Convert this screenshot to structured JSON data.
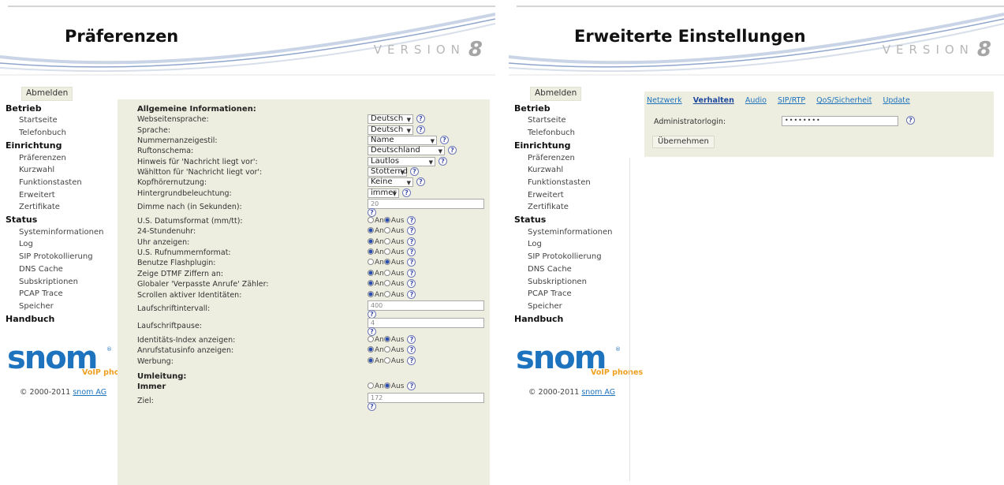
{
  "left": {
    "title": "Präferenzen",
    "version_text": "VERSION",
    "version_number": "8",
    "sidebar": {
      "logout": "Abmelden",
      "sections": [
        {
          "label": "Betrieb",
          "items": [
            "Startseite",
            "Telefonbuch"
          ]
        },
        {
          "label": "Einrichtung",
          "items": [
            "Präferenzen",
            "Kurzwahl",
            "Funktionstasten",
            "Erweitert",
            "Zertifikate"
          ]
        },
        {
          "label": "Status",
          "items": [
            "Systeminformationen",
            "Log",
            "SIP Protokollierung",
            "DNS Cache",
            "Subskriptionen",
            "PCAP Trace",
            "Speicher"
          ]
        },
        {
          "label": "Handbuch",
          "items": []
        }
      ]
    },
    "logo": {
      "word": "snom",
      "sub": "VoIP phones",
      "reg": "®"
    },
    "copyright": {
      "text": "© 2000-2011",
      "link": "snom AG"
    },
    "form": {
      "section1": "Allgemeine Informationen:",
      "rows": [
        {
          "label": "Webseitensprache:",
          "type": "select",
          "value": "Deutsch"
        },
        {
          "label": "Sprache:",
          "type": "select",
          "value": "Deutsch"
        },
        {
          "label": "Nummernanzeigestil:",
          "type": "select",
          "value": "Name"
        },
        {
          "label": "Ruftonschema:",
          "type": "select",
          "value": "Deutschland"
        },
        {
          "label": "Hinweis für 'Nachricht liegt vor':",
          "type": "select",
          "value": "Lautlos"
        },
        {
          "label": "Wähltton für 'Nachricht liegt vor':",
          "type": "select",
          "value": "Stotternd"
        },
        {
          "label": "Kopfhörernutzung:",
          "type": "select",
          "value": "Keine"
        },
        {
          "label": "Hintergrundbeleuchtung:",
          "type": "select",
          "value": "immer"
        },
        {
          "label": "Dimme nach (in Sekunden):",
          "type": "text",
          "value": "20"
        },
        {
          "label": "U.S. Datumsformat (mm/tt):",
          "type": "radio",
          "value": "Aus"
        },
        {
          "label": "24-Stundenuhr:",
          "type": "radio",
          "value": "An"
        },
        {
          "label": "Uhr anzeigen:",
          "type": "radio",
          "value": "An"
        },
        {
          "label": "U.S. Rufnummernformat:",
          "type": "radio",
          "value": "An"
        },
        {
          "label": "Benutze Flashplugin:",
          "type": "radio",
          "value": "Aus"
        },
        {
          "label": "Zeige DTMF Ziffern an:",
          "type": "radio",
          "value": "An"
        },
        {
          "label": "Globaler 'Verpasste Anrufe' Zähler:",
          "type": "radio",
          "value": "An"
        },
        {
          "label": "Scrollen aktiver Identitäten:",
          "type": "radio",
          "value": "An"
        },
        {
          "label": "Laufschriftintervall:",
          "type": "text",
          "value": "400"
        },
        {
          "label": "Laufschriftpause:",
          "type": "text",
          "value": "4"
        },
        {
          "label": "Identitäts-Index anzeigen:",
          "type": "radio",
          "value": "Aus"
        },
        {
          "label": "Anrufstatusinfo anzeigen:",
          "type": "radio",
          "value": "An"
        },
        {
          "label": "Werbung:",
          "type": "radio",
          "value": "An"
        }
      ],
      "section2": "Umleitung:",
      "immer_label": "Immer",
      "immer_value": "Aus",
      "ziel_label": "Ziel:",
      "ziel_value": "172",
      "radio_on": "An",
      "radio_off": "Aus",
      "help": "?"
    }
  },
  "right": {
    "title": "Erweiterte Einstellungen",
    "version_text": "VERSION",
    "version_number": "8",
    "sidebar": {
      "logout": "Abmelden",
      "sections": [
        {
          "label": "Betrieb",
          "items": [
            "Startseite",
            "Telefonbuch"
          ]
        },
        {
          "label": "Einrichtung",
          "items": [
            "Präferenzen",
            "Kurzwahl",
            "Funktionstasten",
            "Erweitert",
            "Zertifikate"
          ]
        },
        {
          "label": "Status",
          "items": [
            "Systeminformationen",
            "Log",
            "SIP Protokollierung",
            "DNS Cache",
            "Subskriptionen",
            "PCAP Trace",
            "Speicher"
          ]
        },
        {
          "label": "Handbuch",
          "items": []
        }
      ]
    },
    "logo": {
      "word": "snom",
      "sub": "VoIP phones",
      "reg": "®"
    },
    "copyright": {
      "text": "© 2000-2011",
      "link": "snom AG"
    },
    "tabs": [
      "Netzwerk",
      "Verhalten",
      "Audio",
      "SIP/RTP",
      "QoS/Sicherheit",
      "Update"
    ],
    "active_tab": "Verhalten",
    "admin_label": "Administratorlogin:",
    "admin_value": "••••••••",
    "apply_label": "Übernehmen",
    "help": "?"
  }
}
